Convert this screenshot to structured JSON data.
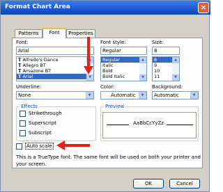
{
  "window": {
    "title": "Format Chart Area",
    "close_glyph": "×"
  },
  "tabs": [
    {
      "label": "Patterns"
    },
    {
      "label": "Font"
    },
    {
      "label": "Properties"
    }
  ],
  "font": {
    "label": "Font:",
    "value": "Arial",
    "items": [
      "Alfredo's Dance",
      "Allegro BT",
      "Amazone BT",
      "Arial"
    ],
    "tt_glyph": "T"
  },
  "font_style": {
    "label": "Font style:",
    "value": "Regular",
    "items": [
      "Regular",
      "Italic",
      "Bold",
      "Bold Italic"
    ]
  },
  "size": {
    "label": "Size:",
    "value": "8",
    "items": [
      "8",
      "9",
      "10",
      "11"
    ]
  },
  "underline": {
    "label": "Underline:",
    "value": "None"
  },
  "color": {
    "label": "Color:",
    "value": "Automatic"
  },
  "background": {
    "label": "Background:",
    "value": "Automatic"
  },
  "effects": {
    "title": "Effects",
    "strikethrough": "Strikethrough",
    "superscript": "Superscript",
    "subscript": "Subscript"
  },
  "preview": {
    "title": "Preview",
    "sample": "AaBbCcYyZz"
  },
  "auto_scale": {
    "label": "Auto scale"
  },
  "info_text": "This is a TrueType font.  The same font will be used on both your printer and your screen.",
  "buttons": {
    "ok": "OK",
    "cancel": "Cancel"
  },
  "annotation_color": "#e0231b"
}
